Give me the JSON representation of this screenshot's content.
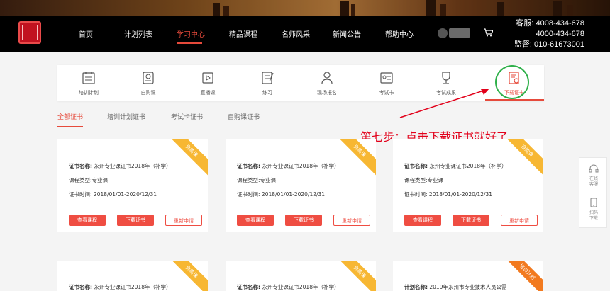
{
  "header": {
    "nav": [
      "首页",
      "计划列表",
      "学习中心",
      "精品课程",
      "名师风采",
      "新闻公告",
      "帮助中心"
    ],
    "active_nav": "学习中心",
    "contact": [
      "客服: 4008-434-678",
      "4000-434-678",
      "监督: 010-61673001"
    ]
  },
  "menu": {
    "items": [
      {
        "label": "培训计划",
        "icon": "calendar-icon"
      },
      {
        "label": "自购课",
        "icon": "purchase-icon"
      },
      {
        "label": "直播课",
        "icon": "live-video-icon"
      },
      {
        "label": "练习",
        "icon": "practice-icon"
      },
      {
        "label": "现场报名",
        "icon": "signup-user-icon"
      },
      {
        "label": "考试卡",
        "icon": "exam-card-icon"
      },
      {
        "label": "考试成果",
        "icon": "trophy-icon"
      },
      {
        "label": "下载证书",
        "icon": "certificate-icon"
      }
    ],
    "active": "下载证书"
  },
  "tabs": [
    "全部证书",
    "培训计划证书",
    "考试卡证书",
    "自购课证书"
  ],
  "annotation": "第七步：点击下载证书就好了",
  "labels": {
    "cert_name": "证书名称:",
    "plan_name": "计划名称:",
    "course_type": "课程类型:",
    "cert_time": "证书时间:",
    "view_course": "查看课程",
    "download": "下载证书",
    "reapply": "重新申请"
  },
  "cards": [
    {
      "ribbon": "自购课",
      "name": "永州专业课证书2018年（补学）",
      "type": "专业课",
      "time": "2018/01/01-2020/12/31"
    },
    {
      "ribbon": "自购课",
      "name": "永州专业课证书2018年（补学）",
      "type": "专业课",
      "time": "2018/01/01-2020/12/31"
    },
    {
      "ribbon": "自购课",
      "name": "永州专业课证书2018年（补学）",
      "type": "专业课",
      "time": "2018/01/01-2020/12/31"
    },
    {
      "ribbon": "自购课",
      "name": "永州专业课证书2018年（补学）"
    },
    {
      "ribbon": "自购课",
      "name": "永州专业课证书2018年（补学）"
    },
    {
      "ribbon": "培训计划",
      "name": "2019年永州市专业技术人员公需"
    }
  ],
  "float_panel": {
    "service": "在线客服",
    "scan": "扫码下载"
  },
  "colors": {
    "accent": "#e64a3b",
    "ribbon_yellow": "#f7b733",
    "ribbon_orange": "#f27a1f",
    "annotation_red": "#e2001a",
    "circle_green": "#2fb04a"
  }
}
